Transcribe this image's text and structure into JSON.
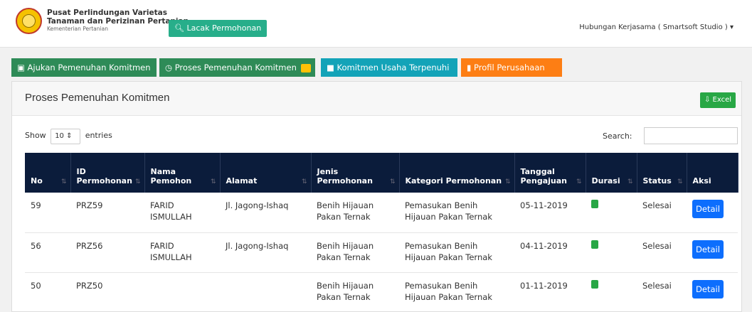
{
  "header": {
    "brand_line1": "Pusat Perlindungan Varietas",
    "brand_line2": "Tanaman dan Perizinan Pertanian",
    "brand_line3": "Kementerian Pertanian",
    "track_button": "Lacak Permohonan",
    "user_menu": "Hubungan Kerjasama ( Smartsoft Studio )"
  },
  "tabs": [
    {
      "label": "Ajukan Pemenuhan Komitmen",
      "icon": "file-icon"
    },
    {
      "label": "Proses Pemenuhan Komitmen",
      "icon": "clock-icon"
    },
    {
      "label": "Komitmen Usaha Terpenuhi",
      "icon": "briefcase-icon"
    },
    {
      "label": "Profil Perusahaan",
      "icon": "book-icon"
    }
  ],
  "panel": {
    "title": "Proses Pemenuhan Komitmen",
    "excel_label": "Excel"
  },
  "controls": {
    "show_label": "Show",
    "entries_value": "10",
    "entries_label": "entries",
    "search_label": "Search:"
  },
  "table": {
    "headers": [
      "No",
      "ID Permohonan",
      "Nama Pemohon",
      "Alamat",
      "Jenis Permohonan",
      "Kategori Permohonan",
      "Tanggal Pengajuan",
      "Durasi",
      "Status",
      "Aksi"
    ],
    "rows": [
      {
        "no": "59",
        "id": "PRZ59",
        "nama": "FARID ISMULLAH",
        "alamat": "Jl. Jagong-Ishaq",
        "jenis": "Benih Hijauan Pakan Ternak",
        "kategori": "Pemasukan Benih Hijauan Pakan Ternak",
        "tanggal": "05-11-2019",
        "status": "Selesai",
        "aksi": "Detail"
      },
      {
        "no": "56",
        "id": "PRZ56",
        "nama": "FARID ISMULLAH",
        "alamat": "Jl. Jagong-Ishaq",
        "jenis": "Benih Hijauan Pakan Ternak",
        "kategori": "Pemasukan Benih Hijauan Pakan Ternak",
        "tanggal": "04-11-2019",
        "status": "Selesai",
        "aksi": "Detail"
      },
      {
        "no": "50",
        "id": "PRZ50",
        "nama": "",
        "alamat": "",
        "jenis": "Benih Hijauan Pakan Ternak",
        "kategori": "Pemasukan Benih Hijauan Pakan Ternak",
        "tanggal": "01-11-2019",
        "status": "Selesai",
        "aksi": "Detail"
      }
    ]
  },
  "colors": {
    "navy_header": "#0b1c3b",
    "green_tab": "#2e8b57",
    "teal_tab": "#13a3b8",
    "orange_tab": "#fd7e14",
    "detail_blue": "#0d6efd"
  }
}
